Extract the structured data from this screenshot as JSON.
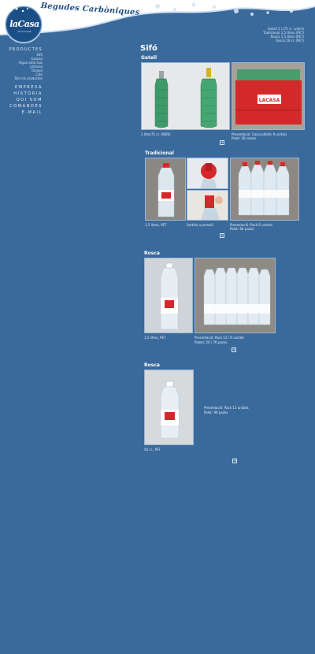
{
  "header": {
    "brand_title": "Begudes Carbòniques",
    "logo_text": "laCasa",
    "logo_sub": "de Cornellà"
  },
  "nav": {
    "productes": "PRODUCTES",
    "items": [
      "Sifó",
      "Gasosa",
      "Aigua amb Gas",
      "Llimona",
      "Taronja",
      "Cola",
      "Tots els productes"
    ],
    "main": [
      "EMPRESA",
      "HISTÒRIA",
      "QUI SOM",
      "COMANDES",
      "E-MAIL"
    ]
  },
  "quick_links": [
    "Gatell 1 l./75 cl. (vidre)",
    "Tradicional 1,5 litres (PET)",
    "Rosca 1,5 litres (PET)",
    "Rosca 50 cl. (PET)"
  ],
  "page": {
    "title": "Sifó"
  },
  "sections": [
    {
      "title": "Gatell",
      "captions": [
        "1 litre/75 cl. VIDRE",
        "Presentació: Caixa plàstic 9 unitats",
        "Palet: 30 caixes"
      ]
    },
    {
      "title": "Tradicional",
      "captions": [
        "1,5 litres, PET",
        "Sortida a pressió",
        "Presentació: Pack 6 unitats",
        "Palet: 64 packs"
      ]
    },
    {
      "title": "Rosca",
      "captions": [
        "1,5 litres, PET",
        "Presentació: Pack 12 / 6 unitats",
        "Palets: 20 / 76 packs"
      ]
    },
    {
      "title": "Rosca",
      "captions": [
        "50 cl., PET",
        "Presentació: Pack 12 unitats",
        "Palet: 96 packs"
      ]
    }
  ],
  "expand_symbol": "+",
  "colors": {
    "background": "#3a6a9c",
    "header_white": "#ffffff",
    "crate_red": "#d4292b",
    "glass_green": "#3f9a6a"
  }
}
